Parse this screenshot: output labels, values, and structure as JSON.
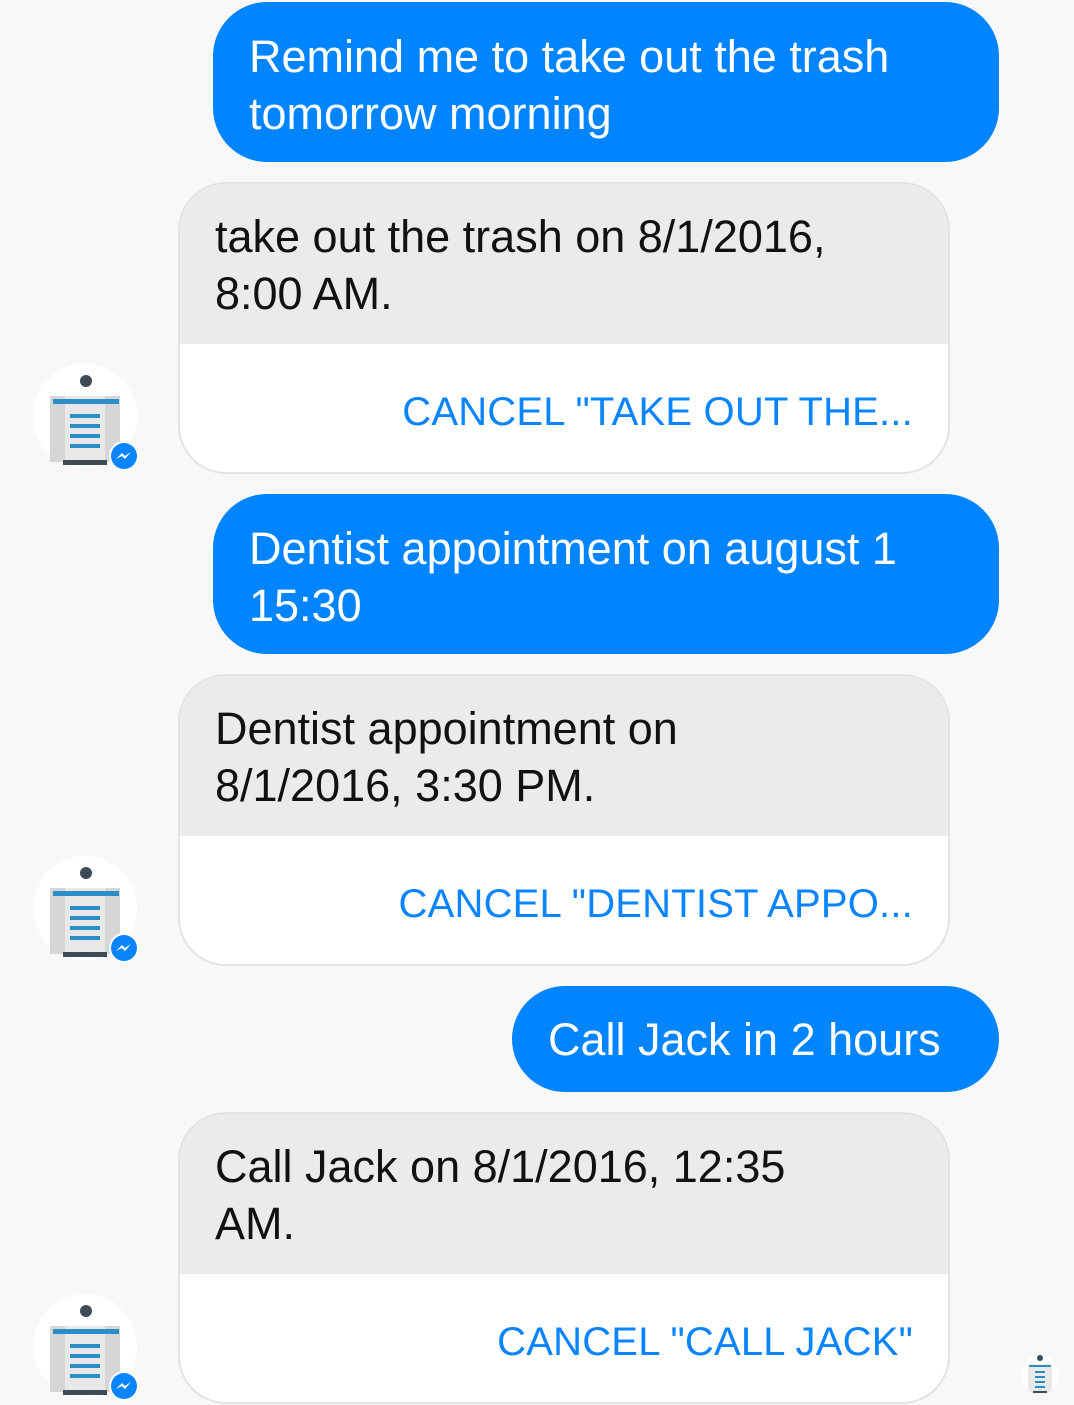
{
  "conversation": {
    "messages": [
      {
        "from": "user",
        "text": "Remind me to take out the trash\ntomorrow morning"
      },
      {
        "from": "bot",
        "text": "take out the trash on 8/1/2016,\n8:00 AM.",
        "action_label": "CANCEL \"TAKE OUT THE..."
      },
      {
        "from": "user",
        "text": "Dentist appointment on august 1\n15:30"
      },
      {
        "from": "bot",
        "text": "Dentist appointment on\n8/1/2016, 3:30 PM.",
        "action_label": "CANCEL \"DENTIST APPO..."
      },
      {
        "from": "user",
        "text": "Call Jack in 2 hours"
      },
      {
        "from": "bot",
        "text": "Call Jack on 8/1/2016, 12:35\nAM.",
        "action_label": "CANCEL \"CALL JACK\""
      }
    ]
  },
  "icons": {
    "bot_avatar": "robot-icon",
    "avatar_badge": "messenger-icon",
    "read_receipt": "robot-icon"
  },
  "colors": {
    "user_bubble": "#0084ff",
    "bot_bubble": "#ebebeb",
    "action_text": "#0a84ff",
    "background": "#f8f8f8"
  }
}
